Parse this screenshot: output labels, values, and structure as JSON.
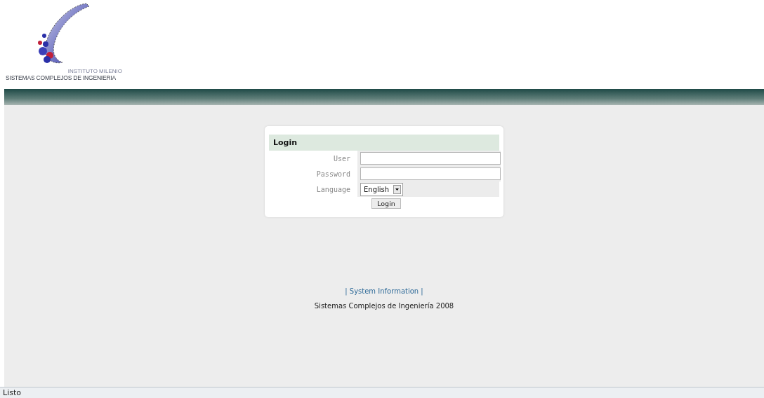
{
  "logo": {
    "top_line": "INSTITUTO MILENIO",
    "name": "SISTEMAS COMPLEJOS DE INGENIERIA"
  },
  "login": {
    "title": "Login",
    "fields": [
      {
        "kind": "text",
        "label": "User"
      },
      {
        "kind": "password",
        "label": "Password"
      },
      {
        "kind": "select",
        "label": "Language",
        "value": "English"
      }
    ],
    "button": "Login"
  },
  "footer": {
    "link": "| System Information |",
    "copyright": "Sistemas Complejos de Ingeniería 2008"
  },
  "status_bar": "Listo"
}
